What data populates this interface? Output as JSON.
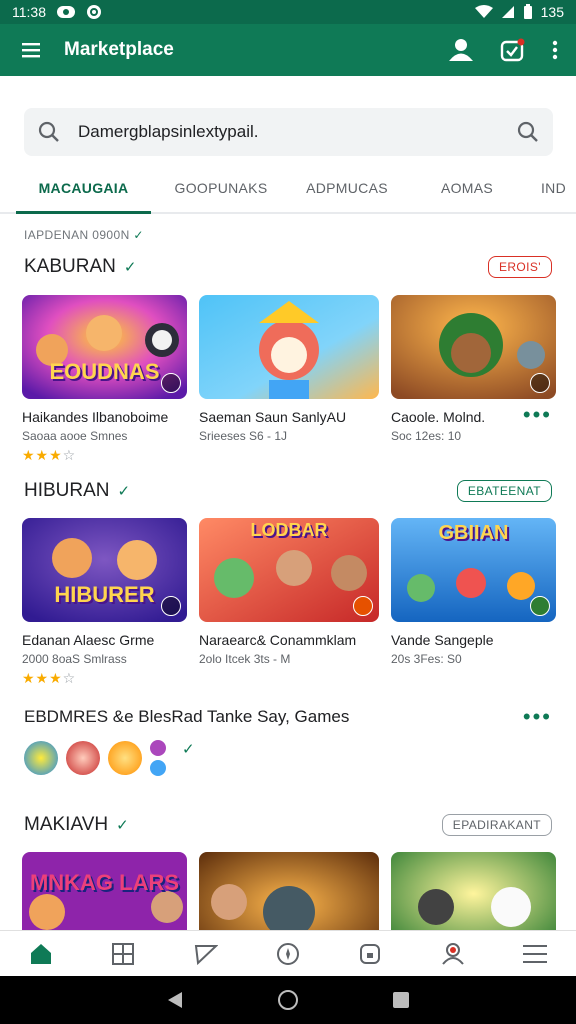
{
  "status_bar": {
    "time": "11:​38",
    "battery": "135"
  },
  "app_bar": {
    "title": "Marketplace"
  },
  "search": {
    "value": "Damergblapsinlextypail."
  },
  "tabs": [
    {
      "label": "MACAUGAIA",
      "active": true
    },
    {
      "label": "GOOPUNAKS",
      "active": false
    },
    {
      "label": "ADPMUCAS",
      "active": false
    },
    {
      "label": "AOMAS",
      "active": false
    },
    {
      "label": "IND",
      "active": false
    }
  ],
  "breadcrumb": "IAPDENAN 0900N",
  "sections": [
    {
      "title": "KABURAN",
      "action": "EROIS'",
      "cards": [
        {
          "name": "Haikandes Ilbanoboime",
          "meta": "Saoaa aooe Smnes",
          "art_label": "EOUDNAS",
          "stars": 3
        },
        {
          "name": "Saeman Saun SanlyAU",
          "meta": "Srieeses  S6  -  1J",
          "art_label": "",
          "stars": 0
        },
        {
          "name": "Caoole. Molnd.",
          "meta": "Soc 12es:  10",
          "art_label": "",
          "stars": 0
        }
      ]
    },
    {
      "title": "HIBURAN",
      "action": "EBATEENAT",
      "cards": [
        {
          "name": "Edanan Alaesc Grme",
          "meta": "2000 8oaS Smlrass",
          "art_label": "HIBURER",
          "stars": 3
        },
        {
          "name": "Naraearc& Conammklam",
          "meta": "2olo Itcek  3ts  -  M",
          "art_label": "LODBAR",
          "stars": 0
        },
        {
          "name": "Vande Sangeple",
          "meta": "20s 3Fes:  S0",
          "art_label": "GBIIAN",
          "stars": 0
        }
      ]
    },
    {
      "title": "EBDMRES &e BlesRad Tanke Say, Games"
    },
    {
      "title": "MAKIAVH",
      "action": "EPADIRAKANT",
      "cards": [
        {
          "name": "",
          "meta": "",
          "art_label": "MNKAG LARS",
          "stars": 0
        },
        {
          "name": "",
          "meta": "",
          "art_label": "",
          "stars": 0
        },
        {
          "name": "",
          "meta": "",
          "art_label": "",
          "stars": 0
        }
      ]
    }
  ],
  "colors": {
    "brand": "#0f7a56",
    "brand_dark": "#0c6a4c",
    "accent_red": "#d93025",
    "star": "#f9ab00"
  }
}
